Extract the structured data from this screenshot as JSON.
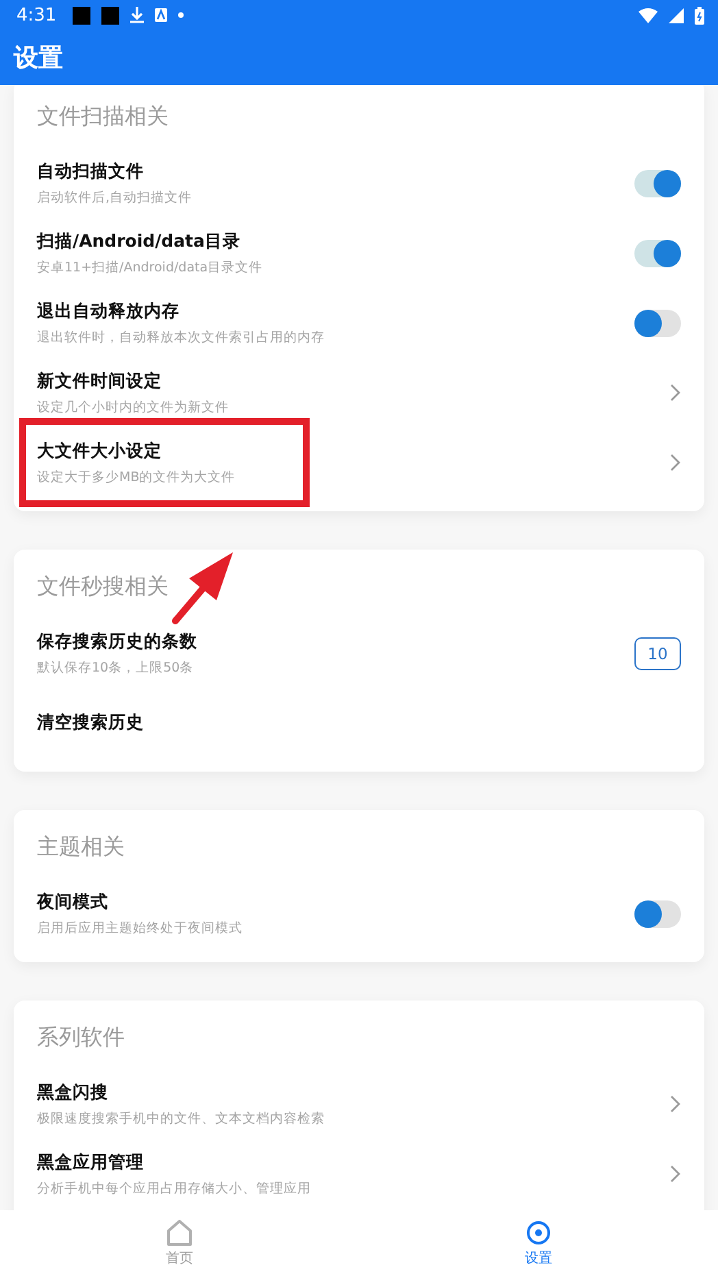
{
  "status_bar": {
    "time": "4:31"
  },
  "app_bar": {
    "title": "设置"
  },
  "sections": [
    {
      "title": "文件扫描相关",
      "items": [
        {
          "kind": "toggle",
          "title": "自动扫描文件",
          "subtitle": "启动软件后,自动扫描文件",
          "on": true
        },
        {
          "kind": "toggle",
          "title": "扫描/Android/data目录",
          "subtitle": "安卓11+扫描/Android/data目录文件",
          "on": true
        },
        {
          "kind": "toggle",
          "title": "退出自动释放内存",
          "subtitle": "退出软件时，自动释放本次文件索引占用的内存",
          "on": false
        },
        {
          "kind": "link",
          "title": "新文件时间设定",
          "subtitle": "设定几个小时内的文件为新文件"
        },
        {
          "kind": "link",
          "title": "大文件大小设定",
          "subtitle": "设定大于多少MB的文件为大文件"
        }
      ]
    },
    {
      "title": "文件秒搜相关",
      "items": [
        {
          "kind": "number",
          "title": "保存搜索历史的条数",
          "subtitle": "默认保存10条，上限50条",
          "value": "10"
        },
        {
          "kind": "plain",
          "title": "清空搜索历史"
        }
      ]
    },
    {
      "title": "主题相关",
      "items": [
        {
          "kind": "toggle",
          "title": "夜间模式",
          "subtitle": "启用后应用主题始终处于夜间模式",
          "on": false
        }
      ]
    },
    {
      "title": "系列软件",
      "items": [
        {
          "kind": "link",
          "title": "黑盒闪搜",
          "subtitle": "极限速度搜索手机中的文件、文本文档内容检索"
        },
        {
          "kind": "link",
          "title": "黑盒应用管理",
          "subtitle": "分析手机中每个应用占用存储大小、管理应用"
        }
      ]
    }
  ],
  "bottom_nav": [
    {
      "label": "首页",
      "selected": false
    },
    {
      "label": "设置",
      "selected": true
    }
  ]
}
